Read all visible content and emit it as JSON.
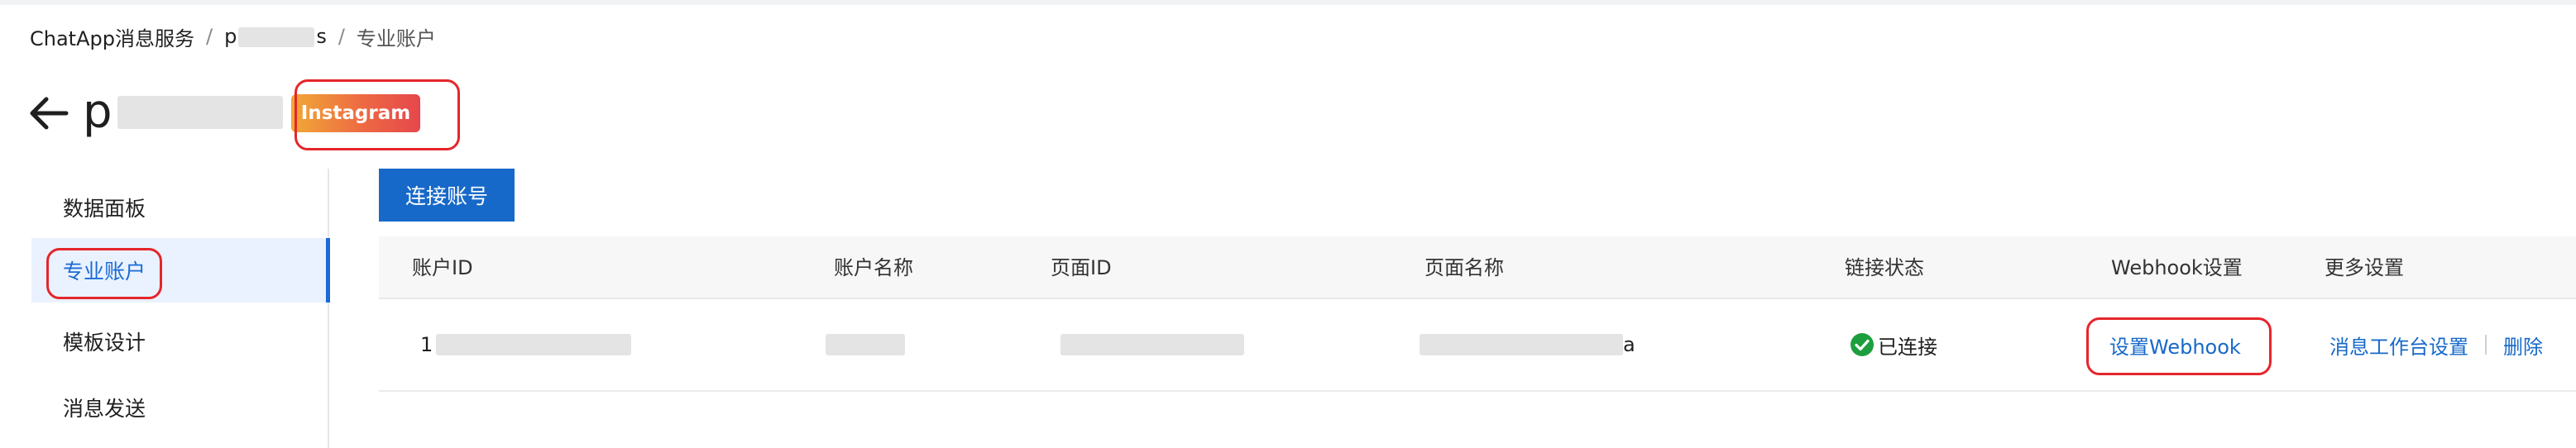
{
  "breadcrumb": {
    "root": "ChatApp消息服务",
    "separator": "/",
    "middle_prefix": "p",
    "middle_suffix": "s",
    "current": "专业账户"
  },
  "header": {
    "title_prefix": "p",
    "channel_badge": "Instagram"
  },
  "sidebar": {
    "items": [
      {
        "label": "数据面板"
      },
      {
        "label": "专业账户"
      },
      {
        "label": "模板设计"
      },
      {
        "label": "消息发送"
      }
    ],
    "active_index": 1
  },
  "toolbar": {
    "connect_label": "连接账号"
  },
  "table": {
    "headers": [
      "账户ID",
      "账户名称",
      "页面ID",
      "页面名称",
      "链接状态",
      "Webhook设置",
      "更多设置"
    ],
    "row": {
      "account_id_prefix": "1",
      "page_name_suffix": "a",
      "status": "已连接",
      "webhook_action": "设置Webhook",
      "workbench_action": "消息工作台设置",
      "delete_action": "删除"
    }
  },
  "colors": {
    "primary": "#1769c9",
    "highlight_outline": "#e5262b",
    "status_ok": "#1d9e3e",
    "badge_gradient_start": "#f0a936",
    "badge_gradient_end": "#e5474c"
  }
}
